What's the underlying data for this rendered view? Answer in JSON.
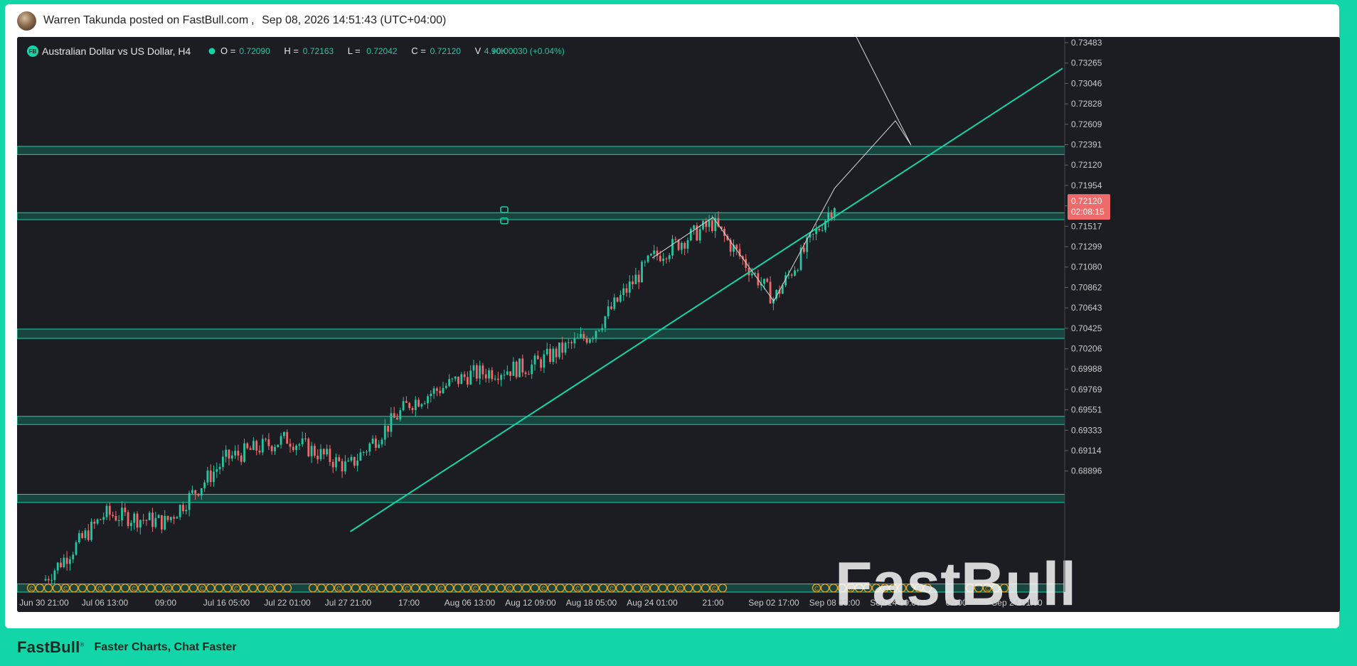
{
  "post": {
    "author_line": "Warren Takunda posted on FastBull.com",
    "separator": ",",
    "timestamp": "Sep 08, 2026 14:51:43 (UTC+04:00)"
  },
  "chart": {
    "badge": "FB",
    "symbol_title": "Australian Dollar vs US Dollar, H4",
    "ohlc": [
      {
        "label": "O = ",
        "value": "0.72090"
      },
      {
        "label": "H = ",
        "value": "0.72163"
      },
      {
        "label": "L = ",
        "value": "0.72042"
      },
      {
        "label": "C = ",
        "value": "0.72120"
      },
      {
        "label": "V ",
        "value": "4.90K"
      }
    ],
    "change": "+0.00030 (+0.04%)",
    "price_tag": {
      "price": "0.72120",
      "countdown": "02:08:15"
    },
    "price_axis": [
      "0.73483",
      "0.73265",
      "0.73046",
      "0.72828",
      "0.72609",
      "0.72391",
      "0.72120",
      "0.71954",
      "0.71735",
      "0.71517",
      "0.71299",
      "0.71080",
      "0.70862",
      "0.70643",
      "0.70425",
      "0.70206",
      "0.69988",
      "0.69769",
      "0.69551",
      "0.69333",
      "0.69114",
      "0.68896"
    ],
    "time_axis": [
      "Jun 30 21:00",
      "Jul 06 13:00",
      "09:00",
      "Jul 16 05:00",
      "Jul 22 01:00",
      "Jul 27 21:00",
      "17:00",
      "Aug 06 13:00",
      "Aug 12 09:00",
      "Aug 18 05:00",
      "Aug 24 01:00",
      "21:00",
      "Sep 02 17:00",
      "Sep 08 13:00",
      "Sep 14 09:00",
      "05:00",
      "Sep 24 01:00"
    ],
    "event_marker_glyph": "C",
    "watermark": "FastBull",
    "colors": {
      "background": "#1c1d22",
      "up": "#26c6a0",
      "down": "#ef6b6b",
      "zone": "#12d6a8",
      "tag": "#ef6b6b",
      "event": "#f0a020"
    }
  },
  "chart_data": {
    "type": "candlestick",
    "title": "Australian Dollar vs US Dollar, H4",
    "ylim": [
      0.6878,
      0.7355
    ],
    "x_start": "Jun 30 21:00",
    "last_candle": {
      "open": 0.7209,
      "high": 0.72163,
      "low": 0.72042,
      "close": 0.7212,
      "volume": "4.90K"
    },
    "price_path": [
      {
        "x": "Jun 30 21:00",
        "close": 0.6888
      },
      {
        "x": "Jul 06 13:00",
        "close": 0.6945
      },
      {
        "x": "09:00",
        "close": 0.6938
      },
      {
        "x": "Jul 16 05:00",
        "close": 0.6993
      },
      {
        "x": "Jul 22 01:00",
        "close": 0.701
      },
      {
        "x": "Jul 27 21:00",
        "close": 0.6985
      },
      {
        "x": "17:00",
        "close": 0.704
      },
      {
        "x": "Aug 06 13:00",
        "close": 0.7065
      },
      {
        "x": "Aug 12 09:00",
        "close": 0.7072
      },
      {
        "x": "Aug 18 05:00",
        "close": 0.71
      },
      {
        "x": "Aug 24 01:00",
        "close": 0.7165
      },
      {
        "x": "21:00",
        "close": 0.7195
      },
      {
        "x": "Sep 02 17:00",
        "close": 0.713
      },
      {
        "x": "Sep 08 13:00",
        "close": 0.7212
      }
    ],
    "zones": [
      {
        "from": 0.7261,
        "to": 0.7254
      },
      {
        "from": 0.7204,
        "to": 0.7198
      },
      {
        "from": 0.7104,
        "to": 0.7096
      },
      {
        "from": 0.7029,
        "to": 0.7022
      },
      {
        "from": 0.6962,
        "to": 0.6955
      },
      {
        "from": 0.6885,
        "to": 0.6878
      }
    ],
    "trendline": [
      {
        "x": "Jul 27 21:00",
        "y": 0.693
      },
      {
        "x": "Sep 24 01:00",
        "y": 0.7328
      }
    ],
    "projection_path": [
      {
        "x": "Aug 24 01:00",
        "y": 0.7165
      },
      {
        "x": "21:00",
        "y": 0.72
      },
      {
        "x": "Sep 02 17:00",
        "y": 0.7128
      },
      {
        "x": "Sep 08 13:00",
        "y": 0.7225
      },
      {
        "x": "Sep 14 09:00",
        "y": 0.7283
      },
      {
        "x": "Sep 14 09:00",
        "y": 0.7262
      },
      {
        "x": "Sep 24 01:00",
        "y": 0.736
      }
    ],
    "ytick_labels": [
      "0.73483",
      "0.73265",
      "0.73046",
      "0.72828",
      "0.72609",
      "0.72391",
      "0.72120",
      "0.71954",
      "0.71735",
      "0.71517",
      "0.71299",
      "0.71080",
      "0.70862",
      "0.70643",
      "0.70425",
      "0.70206",
      "0.69988",
      "0.69769",
      "0.69551",
      "0.69333",
      "0.69114",
      "0.68896"
    ],
    "xtick_labels": [
      "Jun 30 21:00",
      "Jul 06 13:00",
      "09:00",
      "Jul 16 05:00",
      "Jul 22 01:00",
      "Jul 27 21:00",
      "17:00",
      "Aug 06 13:00",
      "Aug 12 09:00",
      "Aug 18 05:00",
      "Aug 24 01:00",
      "21:00",
      "Sep 02 17:00",
      "Sep 08 13:00",
      "Sep 14 09:00",
      "05:00",
      "Sep 24 01:00"
    ]
  },
  "footer": {
    "brand": "FastBull",
    "trademark": "®",
    "tagline": "Faster Charts, Chat Faster"
  }
}
